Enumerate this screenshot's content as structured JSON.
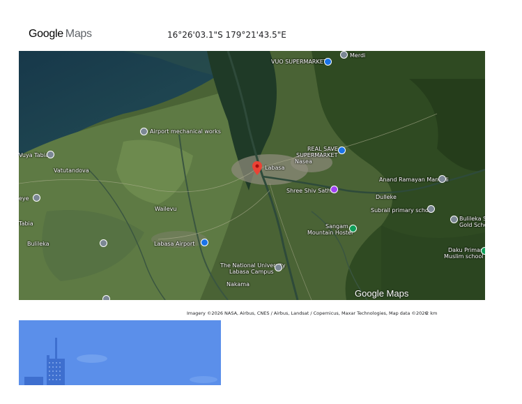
{
  "header": {
    "logo_google": "Google",
    "logo_maps": "Maps",
    "coordinates": "16°26'03.1\"S 179°21'43.5\"E"
  },
  "map": {
    "labels": {
      "merdi": "Merdi",
      "vuo_supermarket": "VUO SUPERMARKET",
      "airport_road": "Airport mechanical works",
      "vuya_tabia": "Vuya Tabia",
      "vatutandova": "Vatutandova",
      "real_save_1": "REAL SAVE",
      "real_save_2": "SUPERMARKET",
      "labasa": "Labasa",
      "anand": "Anand Ramayan Mandali",
      "dulleke": "Dulleke",
      "subrail": "Subrail primary school",
      "nasea": "Nasea",
      "wailevu": "Wailevu",
      "labasa_airport": "Labasa Airport",
      "bulileka": "Bulileka",
      "tabia": "Tabia",
      "sangam_1": "Sangam",
      "sangam_2": "Mountain Hostel",
      "usp_1": "The National University",
      "usp_2": "Labasa Campus",
      "nakama": "Nakama",
      "edge_e": "eye",
      "school_r1": "Bulileka Sanatan",
      "school_r2": "Gold School",
      "school_r3": "Daku Primary",
      "school_r4": "Muslim school",
      "shiv_temple": "Shree Shiv Sathi"
    },
    "pin_color": "#ea4335",
    "watermark": "Google Maps"
  },
  "footer": {
    "attribution": "Imagery ©2026 NASA, Airbus, CNES / Airbus, Landsat / Copernicus, Maxar Technologies, Map data ©2026",
    "scale": "2 km"
  }
}
